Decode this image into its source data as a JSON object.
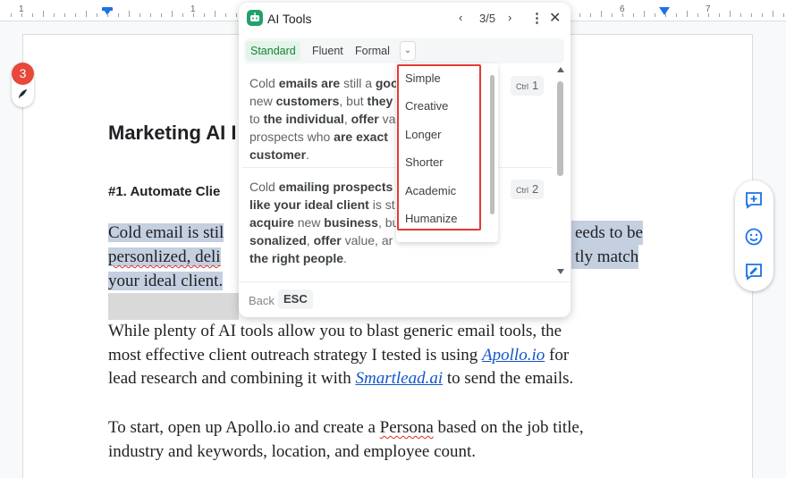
{
  "ruler": {
    "numbers": [
      "1",
      "1",
      "6",
      "7"
    ]
  },
  "document": {
    "heading": "Marketing AI I",
    "subheading": "#1. Automate Clie",
    "selected_lines": [
      {
        "left": "Cold email is stil",
        "right": "eeds to be"
      },
      {
        "left": "personlized, deli",
        "right": "tly match"
      },
      {
        "left": "your ideal client.",
        "right": ""
      }
    ],
    "para2": {
      "t1": "While plenty of AI tools allow you to blast generic email tools, the",
      "t2a": "most effective client outreach strategy I tested is using ",
      "link1": "Apollo.io",
      "t2b": " for",
      "t3a": "lead research and combining it with ",
      "link2": "Smartlead.ai",
      "t3b": " to send the emails."
    },
    "para3": {
      "t1a": "To start, open up Apollo.io and create a ",
      "persona": "Persona",
      "t1b": " based on the job title,",
      "t2": "industry and keywords, location, and employee count."
    }
  },
  "badge": {
    "count": "3"
  },
  "ai_tools": {
    "title": "AI Tools",
    "prev": "‹",
    "counter": "3/5",
    "next": "›",
    "more": "⋮",
    "close": "✕",
    "tabs": {
      "standard": "Standard",
      "fluent": "Fluent",
      "formal": "Formal",
      "more": "⌄"
    },
    "card1": {
      "shortcut_mod": "Ctrl",
      "shortcut_key": "1",
      "l1a": "Cold ",
      "l1b": "emails are",
      "l1c": " still a ",
      "l1d": "goo",
      "l2a": "new ",
      "l2b": "customers",
      "l2c": ", but ",
      "l2d": "they",
      "l3a": "to ",
      "l3b": "the individual",
      "l3c": ", ",
      "l3d": "offer",
      "l3e": " va",
      "l4a": "prospects who ",
      "l4b": "are exact",
      "l5a": "customer",
      "l5b": "."
    },
    "card2": {
      "shortcut_mod": "Ctrl",
      "shortcut_key": "2",
      "l1a": "Cold ",
      "l1b": "emailing prospects",
      "l2a": "like your ideal client",
      "l2b": " is st",
      "l3a": "acquire",
      "l3b": " new ",
      "l3c": "business",
      "l3d": ", bu",
      "l4a": "sonalized",
      "l4b": ", ",
      "l4c": "offer",
      "l4d": " value, ar",
      "l5a": "the right people",
      "l5b": "."
    },
    "footer": {
      "back": "Back",
      "esc": "ESC"
    }
  },
  "dropdown": {
    "options": [
      "Simple",
      "Creative",
      "Longer",
      "Shorter",
      "Academic",
      "Humanize"
    ]
  },
  "colors": {
    "accent_green": "#22a06b",
    "selection": "#c4cfe0",
    "highlight_outline": "#e53935",
    "link": "#1155cc",
    "badge": "#e8473c",
    "float_icons": "#1a73e8"
  }
}
